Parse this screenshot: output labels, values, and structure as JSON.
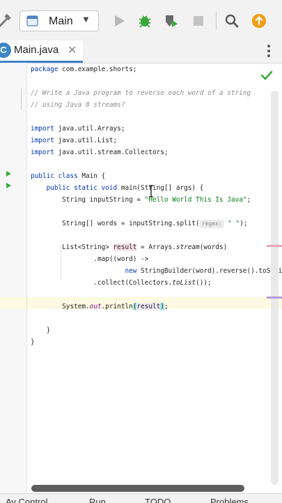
{
  "toolbar": {
    "run_config": "Main",
    "dropdown_arrow": "▼",
    "icons": [
      "hammer-icon",
      "run-icon",
      "debug-icon",
      "coverage-icon",
      "stop-icon",
      "search-icon",
      "update-icon"
    ],
    "colors": {
      "run": "#b8b8b8",
      "debug": "#3aa83a",
      "update": "#f39c12"
    }
  },
  "tab": {
    "badge": "C",
    "name": "Main.java",
    "close": "✕"
  },
  "code": {
    "lines": [
      {
        "kw": "package",
        "rest": " com.example.shorts;"
      },
      {
        "text": ""
      },
      {
        "comment": "// Write a Java program to reverse each word of a string"
      },
      {
        "comment": "// using Java 8 streams?"
      },
      {
        "text": ""
      },
      {
        "kw": "import",
        "rest": " java.util.Arrays;"
      },
      {
        "kw": "import",
        "rest": " java.util.List;"
      },
      {
        "kw": "import",
        "rest": " java.util.stream.Collectors;"
      },
      {
        "text": ""
      },
      {
        "kw": "public class",
        "rest": " Main {"
      },
      {
        "kw": "    public static void",
        "rest": " main(String[] args) {"
      },
      {
        "pre": "        String inputString = ",
        "str": "\"Hello World This Is Java\"",
        "post": ";"
      },
      {
        "text": ""
      },
      {
        "pre": "        String[] words = inputString.split(",
        "hint": "regex:",
        "str": "\" \"",
        "post": ");"
      },
      {
        "text": ""
      },
      {
        "pre": "        List<String> ",
        "var": "result",
        "mid": " = Arrays.",
        "st": "stream",
        "post": "(words)"
      },
      {
        "text": "                .map((word) ->"
      },
      {
        "kw2": "                        new",
        "rest": " StringBuilder(word).reverse().toString("
      },
      {
        "pre": "                .collect(Collectors.",
        "st": "toList",
        "post": "());"
      },
      {
        "text": ""
      },
      {
        "pre": "        System.",
        "fld": "out",
        "mid": ".println",
        "open": "(",
        "arg": "result",
        "close": ")",
        "post": ";"
      },
      {
        "text": ""
      },
      {
        "text": "    }"
      },
      {
        "text": "}"
      }
    ]
  },
  "bottom": {
    "items": [
      "Av Control",
      "Run",
      "TODO",
      "Problems"
    ]
  }
}
